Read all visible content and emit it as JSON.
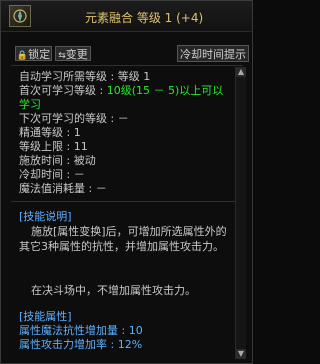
{
  "title": "元素融合 等级 1 (+4)",
  "buttons": {
    "lock": "锁定",
    "change": "变更",
    "cooldown": "冷却时间提示"
  },
  "info_lines": [
    {
      "label": "自动学习所需等级",
      "value": "等级 1"
    },
    {
      "label": "首次可学习等级",
      "value": "10级(15 － 5)以上可以",
      "cont": "学习"
    },
    {
      "label": "下次可学习的等级",
      "value": "－"
    },
    {
      "label": "精通等级",
      "value": "1"
    },
    {
      "label": "等级上限",
      "value": "11"
    },
    {
      "label": "施放时间",
      "value": "被动"
    },
    {
      "label": "冷却时间",
      "value": "－"
    },
    {
      "label": "魔法值消耗量",
      "value": "－"
    }
  ],
  "description": {
    "header": "[技能说明]",
    "text1": "施放[属性变换]后，可增加所选属性外的其它3种属性的抗性，并增加属性攻击力。",
    "text2": "在决斗场中，不增加属性攻击力。"
  },
  "attributes": {
    "header": "[技能属性]",
    "line1": "属性魔法抗性增加量 : 10",
    "line2": "属性攻击力增加率 : 12%"
  }
}
